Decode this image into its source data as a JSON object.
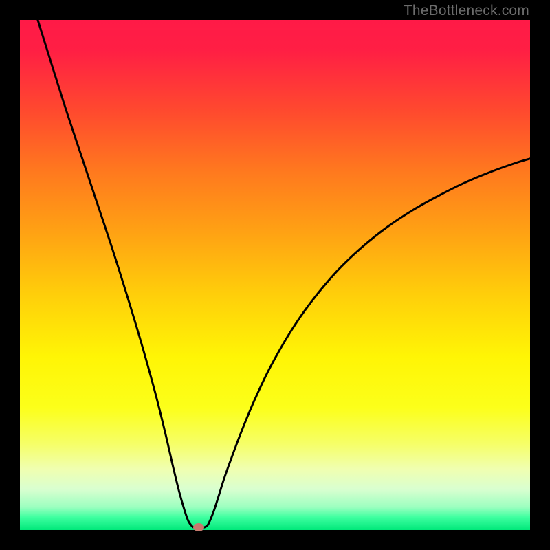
{
  "watermark": "TheBottleneck.com",
  "chart_data": {
    "type": "line",
    "title": "",
    "xlabel": "",
    "ylabel": "",
    "xlim": [
      0,
      100
    ],
    "ylim": [
      0,
      100
    ],
    "gradient_stops": [
      {
        "pos": 0.0,
        "color": "#ff1a47"
      },
      {
        "pos": 0.06,
        "color": "#ff1f44"
      },
      {
        "pos": 0.18,
        "color": "#ff4a2e"
      },
      {
        "pos": 0.3,
        "color": "#ff7a1e"
      },
      {
        "pos": 0.42,
        "color": "#ffa313"
      },
      {
        "pos": 0.54,
        "color": "#ffcf0a"
      },
      {
        "pos": 0.66,
        "color": "#fff505"
      },
      {
        "pos": 0.76,
        "color": "#fcff1a"
      },
      {
        "pos": 0.83,
        "color": "#f6ff66"
      },
      {
        "pos": 0.88,
        "color": "#f0ffb0"
      },
      {
        "pos": 0.92,
        "color": "#d9ffd0"
      },
      {
        "pos": 0.955,
        "color": "#9cffc0"
      },
      {
        "pos": 0.975,
        "color": "#3effa0"
      },
      {
        "pos": 1.0,
        "color": "#00e87a"
      }
    ],
    "series": [
      {
        "name": "bottleneck-curve",
        "color": "#000000",
        "width": 3,
        "x": [
          3.5,
          6,
          9,
          12,
          15,
          18,
          21,
          24,
          26.5,
          28.5,
          30,
          31.2,
          32.2,
          33,
          33.8,
          34.5,
          35.2,
          35.9,
          36.5,
          37,
          38,
          39,
          40,
          41.5,
          43.5,
          46,
          49,
          53,
          57,
          62,
          67,
          72,
          77,
          82,
          87,
          92,
          97,
          100
        ],
        "y": [
          100,
          92,
          82.5,
          73.5,
          64.5,
          55.5,
          46,
          36,
          27,
          19,
          12.5,
          7.6,
          4.1,
          1.8,
          0.7,
          0.35,
          0.35,
          0.45,
          0.7,
          1.3,
          3.7,
          6.8,
          10,
          14.2,
          19.5,
          25.5,
          31.8,
          38.8,
          44.6,
          50.6,
          55.4,
          59.4,
          62.7,
          65.5,
          68,
          70.1,
          71.9,
          72.8
        ]
      }
    ],
    "marker": {
      "x": 35.0,
      "y": 0.5,
      "color": "#c87a6e"
    }
  }
}
